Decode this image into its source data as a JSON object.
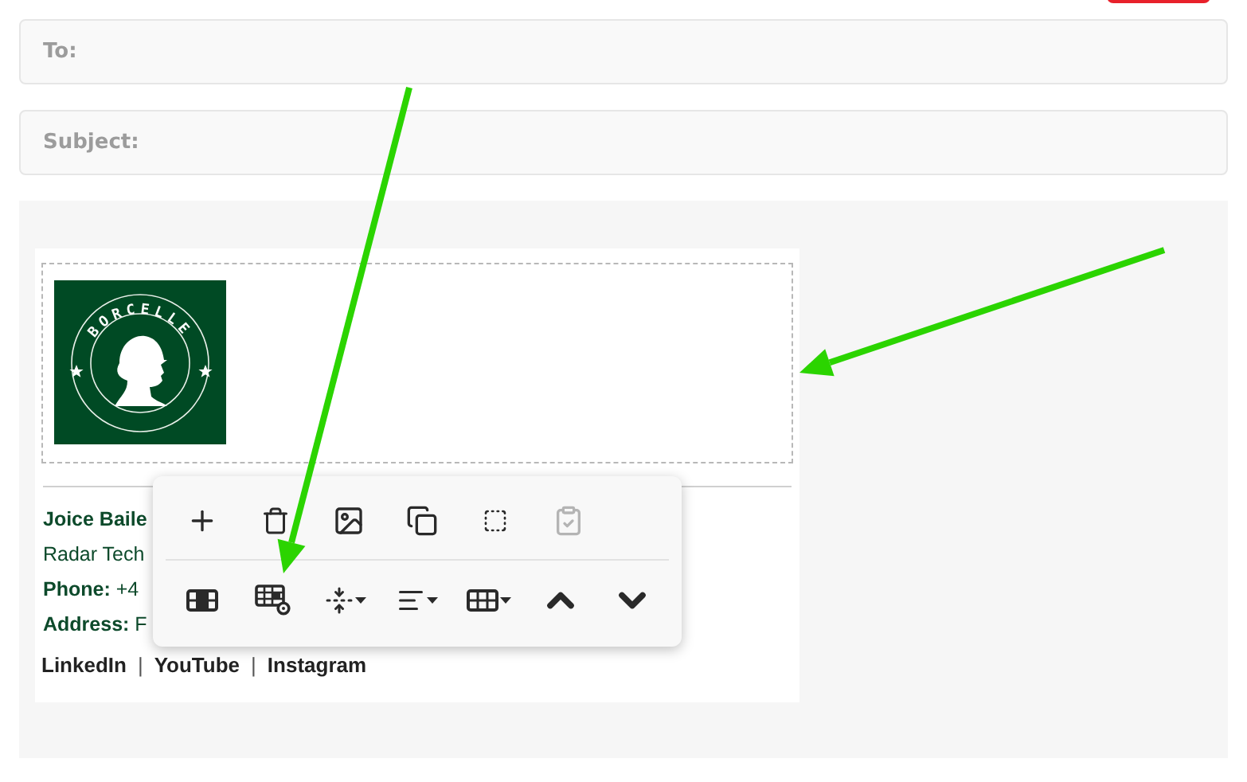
{
  "top_button": {
    "kind": "button"
  },
  "fields": [
    {
      "label": "To:"
    },
    {
      "label": "Subject:"
    }
  ],
  "logo": {
    "text": "BORCELLE"
  },
  "signature": {
    "name": "Joice Baile",
    "company": "Radar Tech",
    "lines": [
      "**Phone:** +4",
      "**Address:** F"
    ],
    "links": [
      {
        "kind": "link",
        "text": "LinkedIn"
      },
      {
        "kind": "separator",
        "text": "|"
      },
      {
        "kind": "link",
        "text": "YouTube"
      },
      {
        "kind": "separator",
        "text": "|"
      },
      {
        "kind": "link",
        "text": "Instagram"
      }
    ]
  },
  "toolbar": {
    "rows": [
      [
        {
          "kind": "plus",
          "disabled": false,
          "dropdown": false
        },
        {
          "kind": "trash",
          "disabled": false,
          "dropdown": false
        },
        {
          "kind": "image",
          "disabled": false,
          "dropdown": false
        },
        {
          "kind": "copy",
          "disabled": false,
          "dropdown": false
        },
        {
          "kind": "select",
          "disabled": false,
          "dropdown": false
        },
        {
          "kind": "paste",
          "disabled": true,
          "dropdown": false
        }
      ],
      [
        {
          "kind": "columns",
          "disabled": false,
          "dropdown": false
        },
        {
          "kind": "table-settings",
          "disabled": false,
          "dropdown": false
        },
        {
          "kind": "spacing",
          "disabled": false,
          "dropdown": true
        },
        {
          "kind": "align",
          "disabled": false,
          "dropdown": true
        },
        {
          "kind": "table",
          "disabled": false,
          "dropdown": true
        },
        {
          "kind": "up",
          "disabled": false,
          "dropdown": false
        },
        {
          "kind": "down",
          "disabled": false,
          "dropdown": false
        }
      ]
    ]
  }
}
